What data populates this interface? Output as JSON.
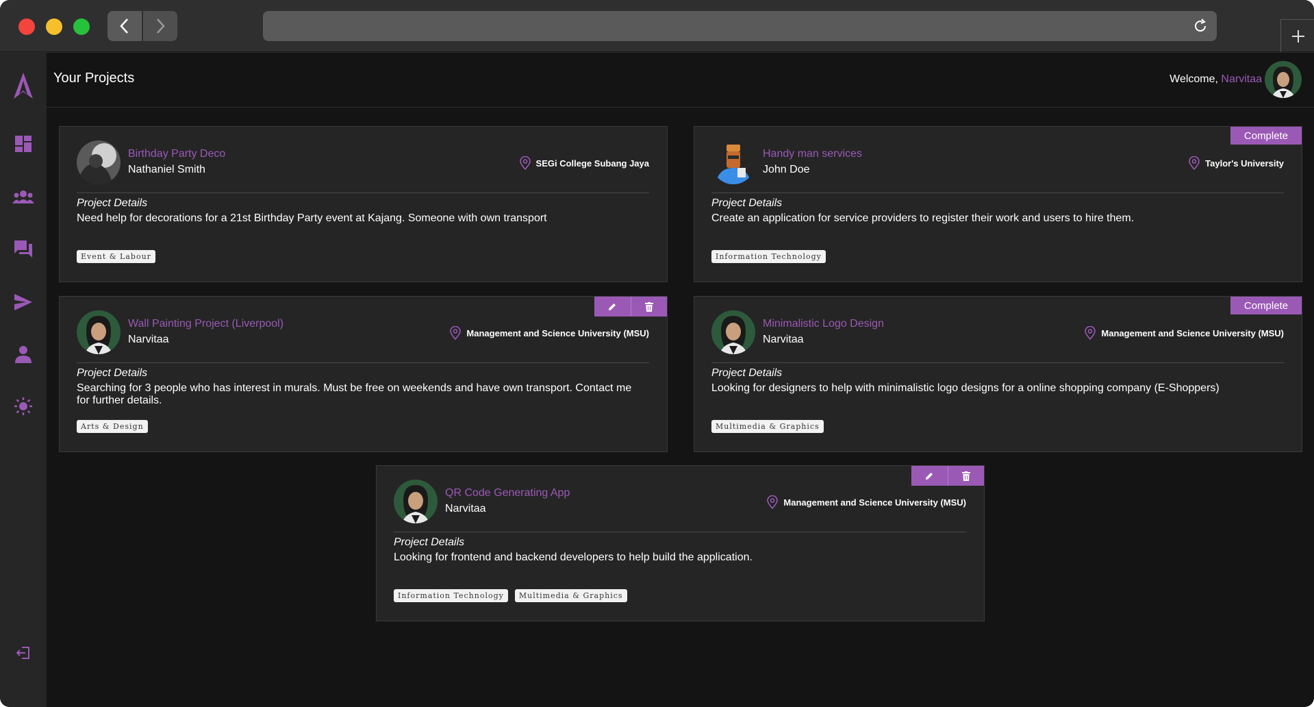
{
  "app": {
    "page_title": "Your Projects",
    "welcome_prefix": "Welcome,",
    "user_name": "Narvitaa",
    "accent_color": "#9b59b6"
  },
  "sidebar": {
    "items": [
      {
        "icon": "logo-icon"
      },
      {
        "icon": "dashboard-icon"
      },
      {
        "icon": "users-icon"
      },
      {
        "icon": "chat-icon"
      },
      {
        "icon": "send-icon"
      },
      {
        "icon": "profile-icon"
      },
      {
        "icon": "sun-icon"
      },
      {
        "icon": "logout-icon"
      }
    ]
  },
  "projects": [
    {
      "title": "Birthday Party Deco",
      "owner": "Nathaniel Smith",
      "location": "SEGi College Subang Jaya",
      "details_label": "Project Details",
      "details": "Need help for decorations for a 21st Birthday Party event at Kajang. Someone with own transport",
      "tags": [
        "Event & Labour"
      ],
      "status": ""
    },
    {
      "title": "Handy man services",
      "owner": "John Doe",
      "location": "Taylor's University",
      "details_label": "Project Details",
      "details": "Create an application for service providers to register their work and users to hire them.",
      "tags": [
        "Information Technology"
      ],
      "status": "Complete"
    },
    {
      "title": "Wall Painting Project (Liverpool)",
      "owner": "Narvitaa",
      "location": "Management and Science University (MSU)",
      "details_label": "Project Details",
      "details": "Searching for 3 people who has interest in murals. Must be free on weekends and have own transport. Contact me for further details.",
      "tags": [
        "Arts & Design"
      ],
      "status": ""
    },
    {
      "title": "Minimalistic Logo Design",
      "owner": "Narvitaa",
      "location": "Management and Science University (MSU)",
      "details_label": "Project Details",
      "details": "Looking for designers to help with minimalistic logo designs for a online shopping company (E-Shoppers)",
      "tags": [
        "Multimedia & Graphics"
      ],
      "status": "Complete"
    },
    {
      "title": "QR Code Generating App",
      "owner": "Narvitaa",
      "location": "Management and Science University (MSU)",
      "details_label": "Project Details",
      "details": "Looking for frontend and backend developers to help build the application.",
      "tags": [
        "Information Technology",
        "Multimedia & Graphics"
      ],
      "status": ""
    }
  ]
}
